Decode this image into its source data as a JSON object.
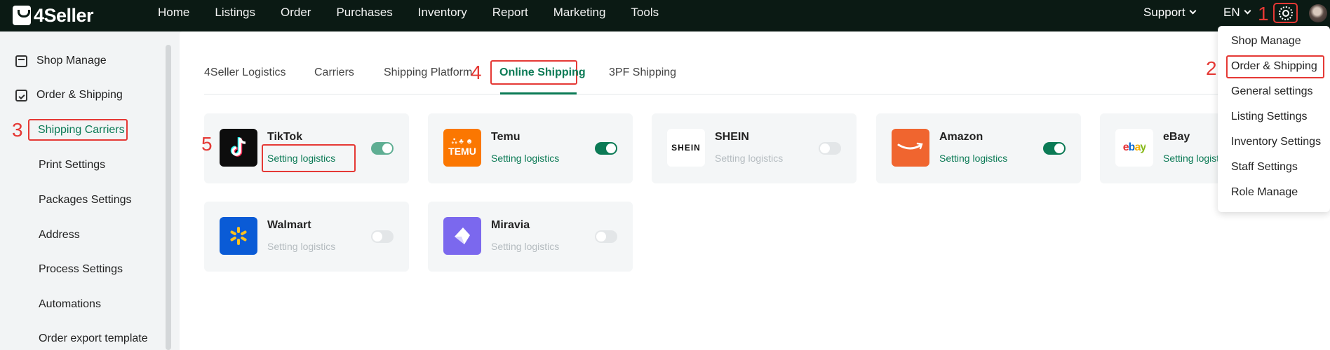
{
  "app": {
    "logo_text": "4Seller"
  },
  "nav": [
    "Home",
    "Listings",
    "Order",
    "Purchases",
    "Inventory",
    "Report",
    "Marketing",
    "Tools"
  ],
  "header": {
    "support": "Support",
    "language": "EN"
  },
  "sidebar": {
    "sections": [
      {
        "label": "Shop Manage",
        "icon": "shop-icon"
      },
      {
        "label": "Order & Shipping",
        "icon": "order-icon"
      }
    ],
    "items": [
      "Shipping Carriers",
      "Print Settings",
      "Packages Settings",
      "Address",
      "Process Settings",
      "Automations",
      "Order export template"
    ],
    "active": "Shipping Carriers"
  },
  "tabs": [
    "4Seller Logistics",
    "Carriers",
    "Shipping Platform",
    "Online Shipping",
    "3PF Shipping"
  ],
  "active_tab": "Online Shipping",
  "cards": [
    {
      "name": "TikTok",
      "link": "Setting logistics",
      "enabled": true,
      "logo_text": ""
    },
    {
      "name": "Temu",
      "link": "Setting logistics",
      "enabled": true,
      "logo_text": "TEMU"
    },
    {
      "name": "SHEIN",
      "link": "Setting logistics",
      "enabled": false,
      "logo_text": "SHEIN"
    },
    {
      "name": "Amazon",
      "link": "Setting logistics",
      "enabled": true,
      "logo_text": ""
    },
    {
      "name": "eBay",
      "link": "Setting logistics",
      "enabled": true,
      "logo_text": "ebay"
    },
    {
      "name": "Walmart",
      "link": "Setting logistics",
      "enabled": false,
      "logo_text": ""
    },
    {
      "name": "Miravia",
      "link": "Setting logistics",
      "enabled": false,
      "logo_text": ""
    }
  ],
  "settings_menu": [
    "Shop Manage",
    "Order & Shipping",
    "General settings",
    "Listing Settings",
    "Inventory Settings",
    "Staff Settings",
    "Role Manage"
  ],
  "annotations": [
    "1",
    "2",
    "3",
    "4",
    "5"
  ],
  "colors": {
    "accent": "#0b7a55",
    "highlight": "#e53935",
    "topbar": "#0b1a14"
  }
}
